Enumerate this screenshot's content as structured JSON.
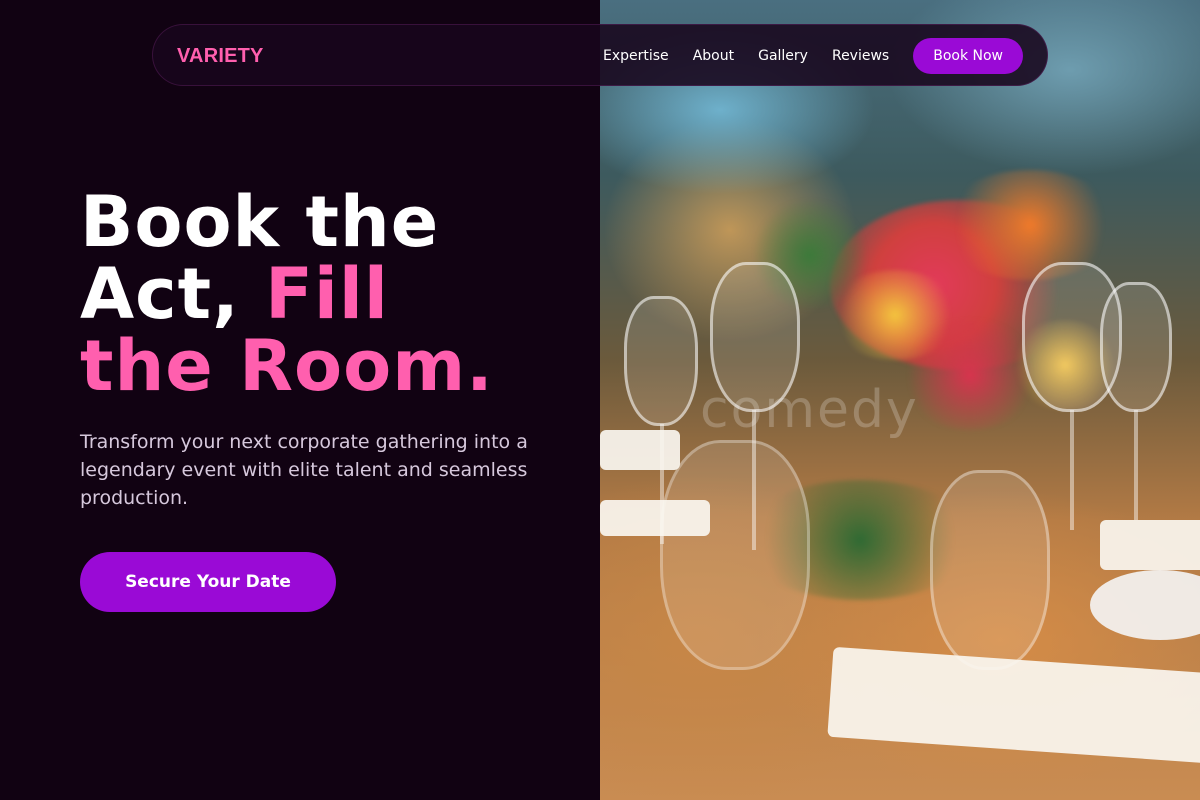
{
  "nav": {
    "brand": "VARIETY",
    "links": [
      "Expertise",
      "About",
      "Gallery",
      "Reviews"
    ],
    "book_now": "Book Now"
  },
  "hero": {
    "title_line1": "Book the",
    "title_line2_plain": "Act, ",
    "title_line2_accent": "Fill",
    "title_line3_accent": "the Room.",
    "subtitle": "Transform your next corporate gathering into a legendary event with elite talent and seamless production.",
    "cta": "Secure Your Date"
  },
  "photo": {
    "watermark": "comedy",
    "description_icon": "event-table-photo"
  },
  "colors": {
    "background": "#110212",
    "accent_pink": "#ff5fae",
    "button_purple": "#9a0ad6"
  }
}
